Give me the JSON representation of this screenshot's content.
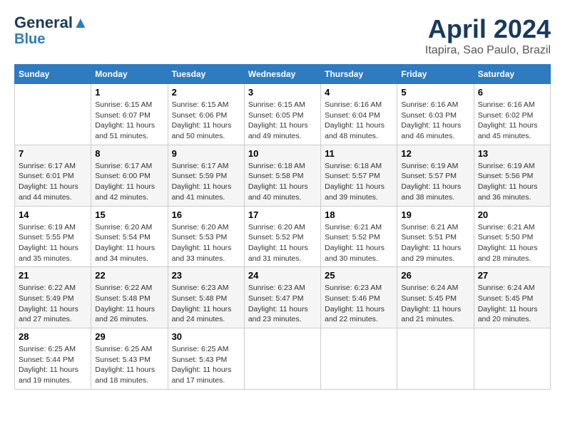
{
  "logo": {
    "line1": "General",
    "line2": "Blue"
  },
  "title": "April 2024",
  "subtitle": "Itapira, Sao Paulo, Brazil",
  "days": [
    "Sunday",
    "Monday",
    "Tuesday",
    "Wednesday",
    "Thursday",
    "Friday",
    "Saturday"
  ],
  "weeks": [
    [
      {
        "date": "",
        "info": ""
      },
      {
        "date": "1",
        "info": "Sunrise: 6:15 AM\nSunset: 6:07 PM\nDaylight: 11 hours\nand 51 minutes."
      },
      {
        "date": "2",
        "info": "Sunrise: 6:15 AM\nSunset: 6:06 PM\nDaylight: 11 hours\nand 50 minutes."
      },
      {
        "date": "3",
        "info": "Sunrise: 6:15 AM\nSunset: 6:05 PM\nDaylight: 11 hours\nand 49 minutes."
      },
      {
        "date": "4",
        "info": "Sunrise: 6:16 AM\nSunset: 6:04 PM\nDaylight: 11 hours\nand 48 minutes."
      },
      {
        "date": "5",
        "info": "Sunrise: 6:16 AM\nSunset: 6:03 PM\nDaylight: 11 hours\nand 46 minutes."
      },
      {
        "date": "6",
        "info": "Sunrise: 6:16 AM\nSunset: 6:02 PM\nDaylight: 11 hours\nand 45 minutes."
      }
    ],
    [
      {
        "date": "7",
        "info": "Sunrise: 6:17 AM\nSunset: 6:01 PM\nDaylight: 11 hours\nand 44 minutes."
      },
      {
        "date": "8",
        "info": "Sunrise: 6:17 AM\nSunset: 6:00 PM\nDaylight: 11 hours\nand 42 minutes."
      },
      {
        "date": "9",
        "info": "Sunrise: 6:17 AM\nSunset: 5:59 PM\nDaylight: 11 hours\nand 41 minutes."
      },
      {
        "date": "10",
        "info": "Sunrise: 6:18 AM\nSunset: 5:58 PM\nDaylight: 11 hours\nand 40 minutes."
      },
      {
        "date": "11",
        "info": "Sunrise: 6:18 AM\nSunset: 5:57 PM\nDaylight: 11 hours\nand 39 minutes."
      },
      {
        "date": "12",
        "info": "Sunrise: 6:19 AM\nSunset: 5:57 PM\nDaylight: 11 hours\nand 38 minutes."
      },
      {
        "date": "13",
        "info": "Sunrise: 6:19 AM\nSunset: 5:56 PM\nDaylight: 11 hours\nand 36 minutes."
      }
    ],
    [
      {
        "date": "14",
        "info": "Sunrise: 6:19 AM\nSunset: 5:55 PM\nDaylight: 11 hours\nand 35 minutes."
      },
      {
        "date": "15",
        "info": "Sunrise: 6:20 AM\nSunset: 5:54 PM\nDaylight: 11 hours\nand 34 minutes."
      },
      {
        "date": "16",
        "info": "Sunrise: 6:20 AM\nSunset: 5:53 PM\nDaylight: 11 hours\nand 33 minutes."
      },
      {
        "date": "17",
        "info": "Sunrise: 6:20 AM\nSunset: 5:52 PM\nDaylight: 11 hours\nand 31 minutes."
      },
      {
        "date": "18",
        "info": "Sunrise: 6:21 AM\nSunset: 5:52 PM\nDaylight: 11 hours\nand 30 minutes."
      },
      {
        "date": "19",
        "info": "Sunrise: 6:21 AM\nSunset: 5:51 PM\nDaylight: 11 hours\nand 29 minutes."
      },
      {
        "date": "20",
        "info": "Sunrise: 6:21 AM\nSunset: 5:50 PM\nDaylight: 11 hours\nand 28 minutes."
      }
    ],
    [
      {
        "date": "21",
        "info": "Sunrise: 6:22 AM\nSunset: 5:49 PM\nDaylight: 11 hours\nand 27 minutes."
      },
      {
        "date": "22",
        "info": "Sunrise: 6:22 AM\nSunset: 5:48 PM\nDaylight: 11 hours\nand 26 minutes."
      },
      {
        "date": "23",
        "info": "Sunrise: 6:23 AM\nSunset: 5:48 PM\nDaylight: 11 hours\nand 24 minutes."
      },
      {
        "date": "24",
        "info": "Sunrise: 6:23 AM\nSunset: 5:47 PM\nDaylight: 11 hours\nand 23 minutes."
      },
      {
        "date": "25",
        "info": "Sunrise: 6:23 AM\nSunset: 5:46 PM\nDaylight: 11 hours\nand 22 minutes."
      },
      {
        "date": "26",
        "info": "Sunrise: 6:24 AM\nSunset: 5:45 PM\nDaylight: 11 hours\nand 21 minutes."
      },
      {
        "date": "27",
        "info": "Sunrise: 6:24 AM\nSunset: 5:45 PM\nDaylight: 11 hours\nand 20 minutes."
      }
    ],
    [
      {
        "date": "28",
        "info": "Sunrise: 6:25 AM\nSunset: 5:44 PM\nDaylight: 11 hours\nand 19 minutes."
      },
      {
        "date": "29",
        "info": "Sunrise: 6:25 AM\nSunset: 5:43 PM\nDaylight: 11 hours\nand 18 minutes."
      },
      {
        "date": "30",
        "info": "Sunrise: 6:25 AM\nSunset: 5:43 PM\nDaylight: 11 hours\nand 17 minutes."
      },
      {
        "date": "",
        "info": ""
      },
      {
        "date": "",
        "info": ""
      },
      {
        "date": "",
        "info": ""
      },
      {
        "date": "",
        "info": ""
      }
    ]
  ]
}
